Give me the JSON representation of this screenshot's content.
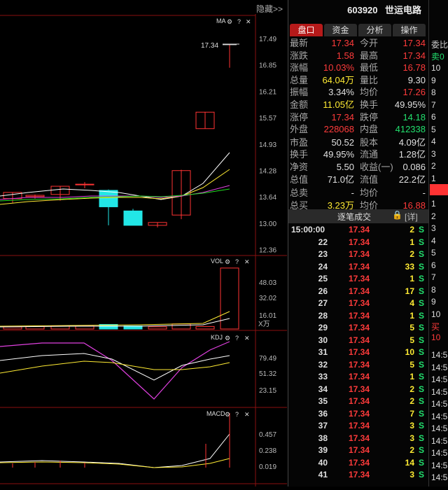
{
  "header": {
    "code": "603920",
    "name": "世运电路",
    "hide_label": "隐藏>>"
  },
  "tabs": [
    "盘口",
    "资金",
    "分析",
    "操作"
  ],
  "quote": [
    {
      "l1": "最新",
      "v1": "17.34",
      "c1": "red",
      "l2": "今开",
      "v2": "17.34",
      "c2": "red"
    },
    {
      "l1": "涨跌",
      "v1": "1.58",
      "c1": "red",
      "l2": "最高",
      "v2": "17.34",
      "c2": "red"
    },
    {
      "l1": "涨幅",
      "v1": "10.03%",
      "c1": "red",
      "l2": "最低",
      "v2": "16.78",
      "c2": "red"
    },
    {
      "l1": "总量",
      "v1": "64.04万",
      "c1": "yellow",
      "l2": "量比",
      "v2": "9.30",
      "c2": "white"
    },
    {
      "l1": "振幅",
      "v1": "3.34%",
      "c1": "white",
      "l2": "均价",
      "v2": "17.26",
      "c2": "red"
    },
    {
      "l1": "金额",
      "v1": "11.05亿",
      "c1": "yellow",
      "l2": "换手",
      "v2": "49.95%",
      "c2": "white"
    },
    {
      "l1": "涨停",
      "v1": "17.34",
      "c1": "red",
      "l2": "跌停",
      "v2": "14.18",
      "c2": "green"
    },
    {
      "l1": "外盘",
      "v1": "228068",
      "c1": "red",
      "l2": "内盘",
      "v2": "412338",
      "c2": "green"
    },
    {
      "l1": "市盈",
      "v1": "50.52",
      "c1": "white",
      "l2": "股本",
      "v2": "4.09亿",
      "c2": "white"
    },
    {
      "l1": "换手",
      "v1": "49.95%",
      "c1": "white",
      "l2": "流通",
      "v2": "1.28亿",
      "c2": "white"
    },
    {
      "l1": "净资",
      "v1": "5.50",
      "c1": "white",
      "l2": "收益(一)",
      "v2": "0.086",
      "c2": "white"
    },
    {
      "l1": "总值",
      "v1": "71.0亿",
      "c1": "white",
      "l2": "流值",
      "v2": "22.2亿",
      "c2": "white"
    },
    {
      "l1": "总卖",
      "v1": "-",
      "c1": "white",
      "l2": "均价",
      "v2": "-",
      "c2": "white"
    },
    {
      "l1": "总买",
      "v1": "3.23万",
      "c1": "yellow",
      "l2": "均价",
      "v2": "16.88",
      "c2": "red"
    }
  ],
  "trades_title": "逐笔成交",
  "trades_detail": "[详]",
  "trades": [
    {
      "t": "15:00:00",
      "p": "17.34",
      "v": "2",
      "s": "S"
    },
    {
      "t": "22",
      "p": "17.34",
      "v": "1",
      "s": "S"
    },
    {
      "t": "23",
      "p": "17.34",
      "v": "2",
      "s": "S"
    },
    {
      "t": "24",
      "p": "17.34",
      "v": "33",
      "s": "S"
    },
    {
      "t": "25",
      "p": "17.34",
      "v": "1",
      "s": "S"
    },
    {
      "t": "26",
      "p": "17.34",
      "v": "17",
      "s": "S"
    },
    {
      "t": "27",
      "p": "17.34",
      "v": "4",
      "s": "S"
    },
    {
      "t": "28",
      "p": "17.34",
      "v": "1",
      "s": "S"
    },
    {
      "t": "29",
      "p": "17.34",
      "v": "5",
      "s": "S"
    },
    {
      "t": "30",
      "p": "17.34",
      "v": "5",
      "s": "S"
    },
    {
      "t": "31",
      "p": "17.34",
      "v": "10",
      "s": "S"
    },
    {
      "t": "32",
      "p": "17.34",
      "v": "5",
      "s": "S"
    },
    {
      "t": "33",
      "p": "17.34",
      "v": "1",
      "s": "S"
    },
    {
      "t": "34",
      "p": "17.34",
      "v": "2",
      "s": "S"
    },
    {
      "t": "35",
      "p": "17.34",
      "v": "2",
      "s": "S"
    },
    {
      "t": "36",
      "p": "17.34",
      "v": "7",
      "s": "S"
    },
    {
      "t": "37",
      "p": "17.34",
      "v": "3",
      "s": "S"
    },
    {
      "t": "38",
      "p": "17.34",
      "v": "3",
      "s": "S"
    },
    {
      "t": "39",
      "p": "17.34",
      "v": "2",
      "s": "S"
    },
    {
      "t": "40",
      "p": "17.34",
      "v": "14",
      "s": "S"
    },
    {
      "t": "41",
      "p": "17.34",
      "v": "3",
      "s": "S"
    }
  ],
  "col3": {
    "top_label": "委比",
    "sell_label": "卖0",
    "sell_levels": [
      "10",
      "9",
      "8",
      "7",
      "6",
      "5",
      "4",
      "3",
      "2",
      "1"
    ],
    "buy_levels": [
      "1",
      "2",
      "3",
      "4",
      "5",
      "6",
      "7",
      "8",
      "9",
      "10"
    ],
    "buy_label": "买10",
    "times": [
      "14:5",
      "14:5",
      "14:5",
      "14:5",
      "14:5",
      "14:5",
      "14:5",
      "14:5",
      "14:5",
      "14:5",
      "14:5"
    ]
  },
  "panes": {
    "ma_title": "MA",
    "vol_title": "VOL",
    "kdj_title": "KDJ",
    "macd_title": "MACD",
    "price_ticks": [
      "17.49",
      "16.85",
      "16.21",
      "15.57",
      "14.93",
      "14.28",
      "13.64",
      "13.00",
      "12.36"
    ],
    "vol_ticks": [
      "48.03",
      "32.02",
      "16.01"
    ],
    "vol_unit": "X万",
    "kdj_ticks": [
      "79.49",
      "51.32",
      "23.15"
    ],
    "macd_ticks": [
      "0.457",
      "0.238",
      "0.019"
    ],
    "last_price_label": "17.34"
  },
  "chart_data": {
    "type": "candlestick",
    "price_axis": {
      "min": 12.36,
      "max": 17.49
    },
    "candles": [
      {
        "o": 13.6,
        "h": 13.75,
        "l": 13.5,
        "c": 13.75
      },
      {
        "o": 13.65,
        "h": 13.7,
        "l": 13.6,
        "c": 13.68
      },
      {
        "o": 13.7,
        "h": 13.9,
        "l": 13.55,
        "c": 13.9
      },
      {
        "o": 13.95,
        "h": 14.0,
        "l": 13.85,
        "c": 13.95
      },
      {
        "o": 13.8,
        "h": 13.82,
        "l": 12.95,
        "c": 13.4
      },
      {
        "o": 13.3,
        "h": 13.35,
        "l": 12.95,
        "c": 12.95
      },
      {
        "o": 12.95,
        "h": 13.02,
        "l": 12.9,
        "c": 13.02
      },
      {
        "o": 13.2,
        "h": 14.3,
        "l": 13.1,
        "c": 14.28
      },
      {
        "o": 15.3,
        "h": 15.7,
        "l": 15.3,
        "c": 15.7
      },
      {
        "o": 17.34,
        "h": 17.34,
        "l": 16.78,
        "c": 17.34
      }
    ],
    "volume": [
      2.0,
      2.5,
      2.8,
      3.0,
      4.5,
      3.0,
      2.2,
      5.0,
      2.5,
      60.0
    ],
    "kdj_axis": {
      "min": 23.15,
      "max": 79.49
    }
  }
}
